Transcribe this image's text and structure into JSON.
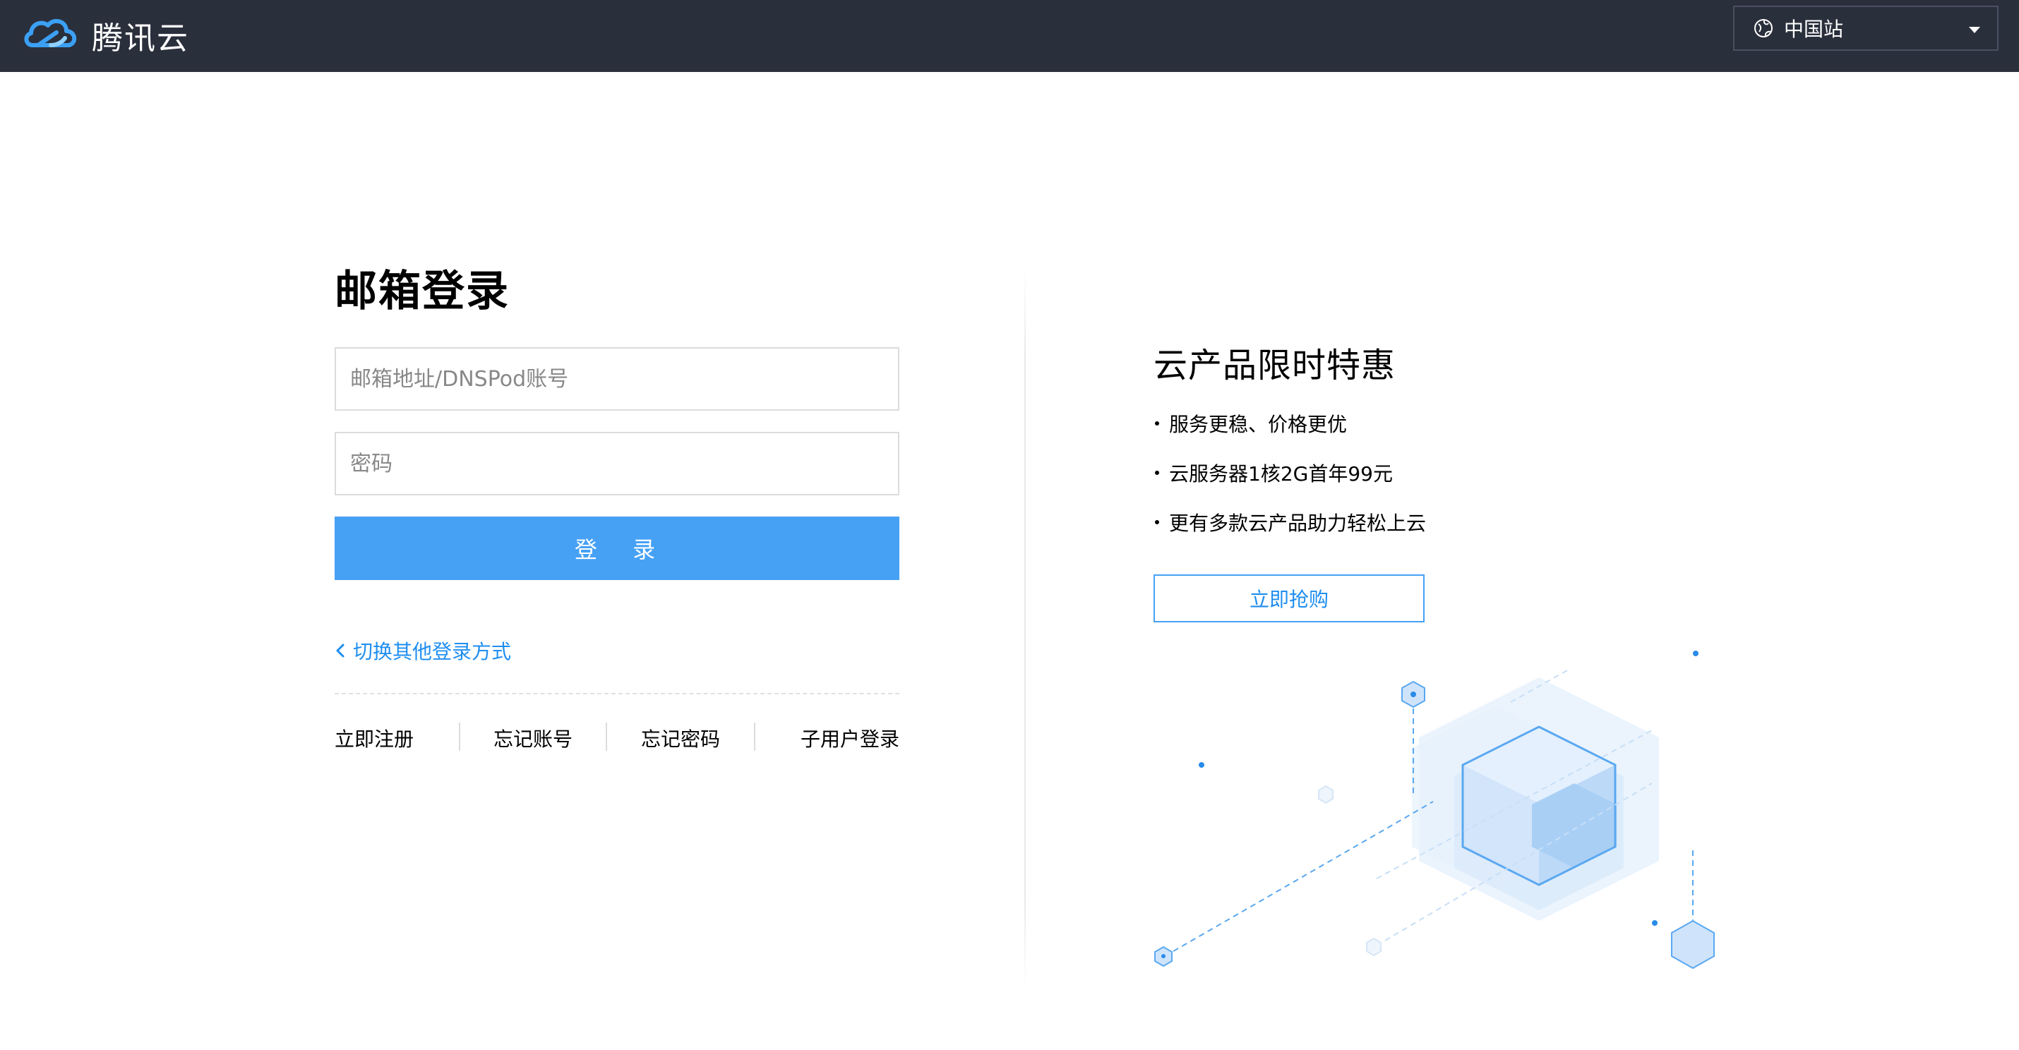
{
  "header": {
    "brand": "腾讯云",
    "site_selector": {
      "selected": "中国站"
    }
  },
  "login": {
    "title": "邮箱登录",
    "email_placeholder": "邮箱地址/DNSPod账号",
    "password_placeholder": "密码",
    "submit_label": "登 录",
    "switch_method": "切换其他登录方式",
    "links": [
      {
        "label": "立即注册"
      },
      {
        "label": "忘记账号"
      },
      {
        "label": "忘记密码"
      },
      {
        "label": "子用户登录"
      }
    ]
  },
  "promo": {
    "title": "云产品限时特惠",
    "items": [
      "服务更稳、价格更优",
      "云服务器1核2G首年99元",
      "更有多款云产品助力轻松上云"
    ],
    "button_label": "立即抢购"
  },
  "colors": {
    "header_bg": "#2a2f3c",
    "primary": "#46a1f5",
    "link": "#1f8ef0"
  },
  "icons": {
    "logo": "tencent-cloud-logo-icon",
    "globe": "globe-icon",
    "caret": "caret-down-icon",
    "chevron": "chevron-left-icon"
  }
}
